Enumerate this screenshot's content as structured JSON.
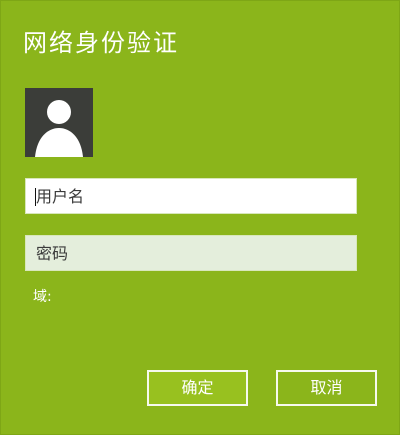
{
  "dialog": {
    "title": "网络身份验证",
    "username_placeholder": "用户名",
    "password_placeholder": "密码",
    "domain_label": "域:",
    "ok_label": "确定",
    "cancel_label": "取消"
  },
  "colors": {
    "background": "#8bb51b",
    "avatar_bg": "#3b3d39",
    "button_border": "#f6f9ee"
  },
  "icons": {
    "avatar": "user-avatar-icon"
  }
}
